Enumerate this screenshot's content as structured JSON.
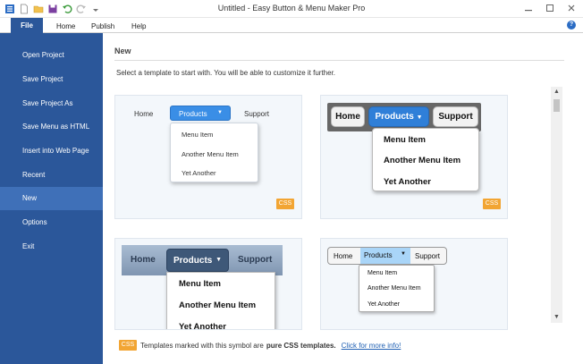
{
  "window": {
    "title": "Untitled - Easy Button & Menu Maker Pro",
    "quick_access_icons": [
      "app-menu-icon",
      "new-file-icon",
      "open-folder-icon",
      "save-icon",
      "undo-icon",
      "redo-icon",
      "customize-qat-icon"
    ],
    "controls": [
      "minimize-icon",
      "maximize-icon",
      "close-icon"
    ]
  },
  "ribbon": {
    "tabs": [
      "File",
      "Home",
      "Publish",
      "Help"
    ],
    "help_icon": "?"
  },
  "sidebar": {
    "items": [
      {
        "label": "Open Project",
        "active": false
      },
      {
        "label": "Save Project",
        "active": false
      },
      {
        "label": "Save Project As",
        "active": false
      },
      {
        "label": "Save Menu as HTML",
        "active": false
      },
      {
        "label": "Insert into Web Page",
        "active": false
      },
      {
        "label": "Recent",
        "active": false
      },
      {
        "label": "New",
        "active": true
      },
      {
        "label": "Options",
        "active": false
      },
      {
        "label": "Exit",
        "active": false
      }
    ]
  },
  "main": {
    "title": "New",
    "instruction": "Select a template to start with. You will be able to customize it further.",
    "templates": [
      {
        "menu": [
          "Home",
          "Products",
          "Support"
        ],
        "dropdown": [
          "Menu Item",
          "Another Menu Item",
          "Yet Another"
        ],
        "badge": "CSS"
      },
      {
        "menu": [
          "Home",
          "Products",
          "Support"
        ],
        "dropdown": [
          "Menu Item",
          "Another Menu Item",
          "Yet Another"
        ],
        "badge": "CSS"
      },
      {
        "menu": [
          "Home",
          "Products",
          "Support"
        ],
        "dropdown": [
          "Menu Item",
          "Another Menu Item",
          "Yet Another"
        ]
      },
      {
        "menu": [
          "Home",
          "Products",
          "Support"
        ],
        "dropdown": [
          "Menu Item",
          "Another Menu Item",
          "Yet Another"
        ]
      }
    ],
    "footer": {
      "badge": "CSS",
      "text_before": "Templates marked with this symbol are",
      "bold_text": "pure CSS templates.",
      "link_text": "Click for more info!"
    }
  },
  "colors": {
    "sidebar_bg": "#2b579a",
    "sidebar_active": "#3f70b8",
    "css_badge": "#f2a533",
    "link": "#1e5fb3"
  }
}
